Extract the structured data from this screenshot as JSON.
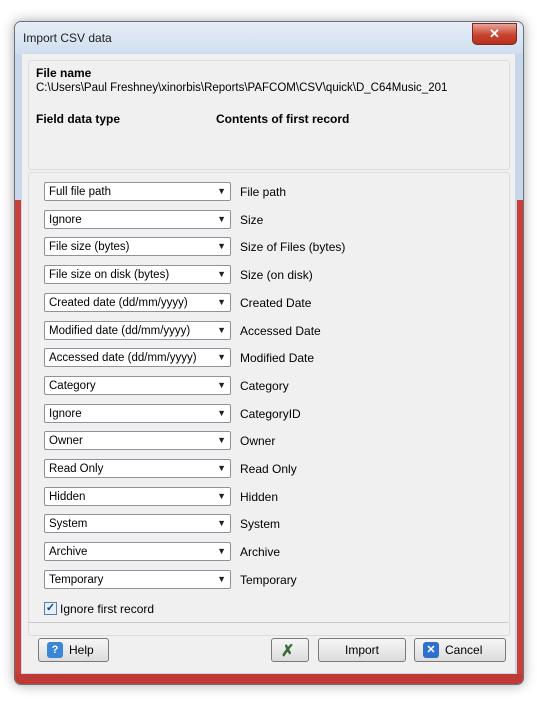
{
  "window": {
    "title": "Import CSV data",
    "close_symbol": "✕"
  },
  "file": {
    "name_label": "File name",
    "path": "C:\\Users\\Paul Freshney\\xinorbis\\Reports\\PAFCOM\\CSV\\quick\\D_C64Music_201"
  },
  "headers": {
    "field_type": "Field data type",
    "contents": "Contents of first record"
  },
  "rows": [
    {
      "type": "Full file path",
      "value": "File path"
    },
    {
      "type": "Ignore",
      "value": "Size"
    },
    {
      "type": "File size (bytes)",
      "value": "Size of Files (bytes)"
    },
    {
      "type": "File size on disk (bytes)",
      "value": "Size (on disk)"
    },
    {
      "type": "Created date (dd/mm/yyyy)",
      "value": "Created Date"
    },
    {
      "type": "Modified date (dd/mm/yyyy)",
      "value": "Accessed Date"
    },
    {
      "type": "Accessed date (dd/mm/yyyy)",
      "value": "Modified Date"
    },
    {
      "type": "Category",
      "value": "Category"
    },
    {
      "type": "Ignore",
      "value": "CategoryID"
    },
    {
      "type": "Owner",
      "value": "Owner"
    },
    {
      "type": "Read Only",
      "value": "Read Only"
    },
    {
      "type": "Hidden",
      "value": "Hidden"
    },
    {
      "type": "System",
      "value": "System"
    },
    {
      "type": "Archive",
      "value": "Archive"
    },
    {
      "type": "Temporary",
      "value": "Temporary"
    }
  ],
  "ignore_first": {
    "label": "Ignore first record",
    "checked": true
  },
  "buttons": {
    "help": "Help",
    "import": "Import",
    "cancel": "Cancel"
  },
  "icons": {
    "help": "help-icon",
    "clear": "x-clear-icon",
    "cancel": "cancel-icon",
    "arrow": "chevron-down-icon"
  },
  "colors": {
    "frame_red": "#c9403a",
    "close_button": "#c7432f",
    "title_bg": "#dce7f3"
  }
}
